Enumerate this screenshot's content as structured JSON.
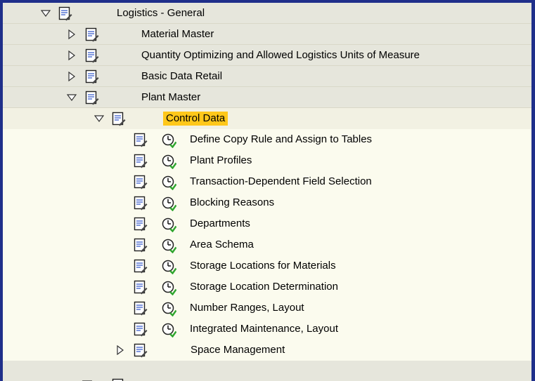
{
  "tree": {
    "root": {
      "label": "Logistics - General",
      "expanded": true
    },
    "children": [
      {
        "label": "Material Master",
        "expanded": false
      },
      {
        "label": "Quantity Optimizing and Allowed Logistics Units of Measure",
        "expanded": false
      },
      {
        "label": "Basic Data Retail",
        "expanded": false
      },
      {
        "label": "Plant Master",
        "expanded": true
      }
    ],
    "plant_master": {
      "control_data": {
        "label": "Control Data",
        "selected": true,
        "items": [
          "Define Copy Rule and Assign to Tables",
          "Plant Profiles",
          "Transaction-Dependent Field Selection",
          "Blocking Reasons",
          "Departments",
          "Area Schema",
          "Storage Locations for Materials",
          "Storage Location Determination",
          "Number Ranges, Layout",
          "Integrated Maintenance, Layout"
        ]
      },
      "space_management": {
        "label": "Space Management",
        "expanded": false
      }
    }
  },
  "colors": {
    "frame": "#1f2f8a",
    "highlight": "#ffc71a",
    "clock_green": "#2fa52f"
  },
  "icons": {
    "node": "document-edit-icon",
    "activity": "execute-clock-icon",
    "collapsed": "triangle-right-icon",
    "expanded": "triangle-down-icon"
  }
}
